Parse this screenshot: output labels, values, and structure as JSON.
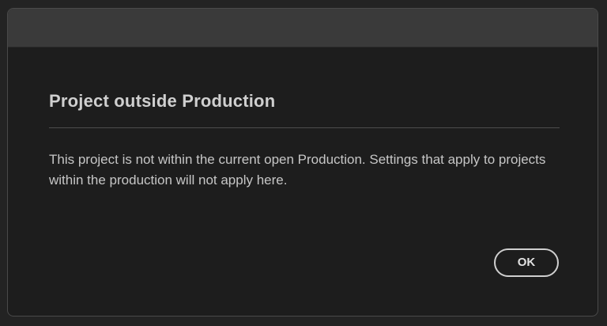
{
  "dialog": {
    "title": "Project outside Production",
    "message": "This project is not within the current open Production. Settings that apply to projects within the production will not apply here.",
    "ok_label": "OK"
  },
  "colors": {
    "background": "#1d1d1d",
    "titlebar": "#3a3a3a",
    "text": "#c6c6c6",
    "button_border": "#cfcfcf"
  }
}
